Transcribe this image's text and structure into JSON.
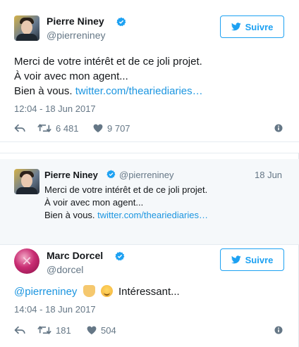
{
  "colors": {
    "accent": "#1da1f2",
    "link": "#1b95e0",
    "muted": "#657786",
    "verified": "#1da1f2"
  },
  "tweet1": {
    "name": "Pierre Niney",
    "handle": "@pierreniney",
    "follow_label": "Suivre",
    "line1": "Merci de votre intérêt et de ce joli projet.",
    "line2": "À voir avec mon agent...",
    "line3_text": "Bien à vous.",
    "line3_link": "twitter.com/theariediaries…",
    "timestamp": "12:04 - 18 Jun 2017",
    "retweets": "6 481",
    "likes": "9 707",
    "icons": [
      "reply-icon",
      "retweet-icon",
      "heart-icon",
      "info-icon"
    ]
  },
  "quoted": {
    "name": "Pierre Niney",
    "handle": "@pierreniney",
    "date": "18 Jun",
    "line1": "Merci de votre intérêt et de ce joli projet.",
    "line2": "À voir avec mon agent...",
    "line3_text": "Bien à vous.",
    "line3_link": "twitter.com/theariediaries…"
  },
  "tweet2": {
    "name": "Marc Dorcel",
    "handle": "@dorcel",
    "follow_label": "Suivre",
    "mention": "@pierreniney",
    "text": "Intéressant...",
    "emojis": [
      "person-gesturing-emoji",
      "relieved-face-emoji"
    ],
    "timestamp": "14:04 - 18 Jun 2017",
    "retweets": "181",
    "likes": "504",
    "icons": [
      "reply-icon",
      "retweet-icon",
      "heart-icon",
      "info-icon"
    ]
  }
}
